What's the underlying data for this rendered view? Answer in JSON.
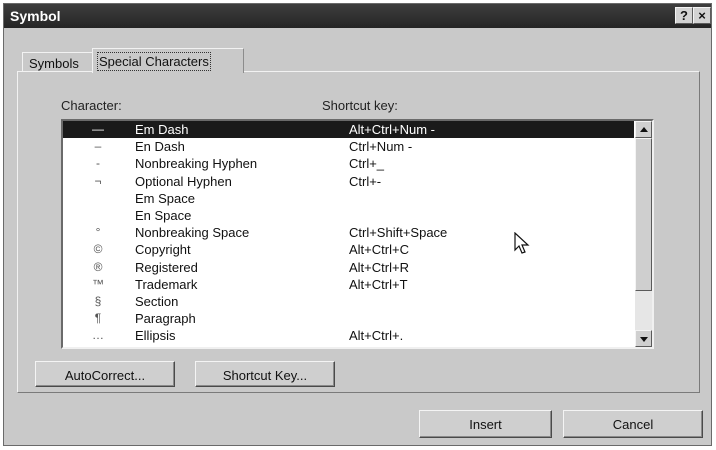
{
  "window": {
    "title": "Symbol"
  },
  "titlebar_buttons": {
    "help": "?",
    "close": "×"
  },
  "tabs": [
    {
      "label": "Symbols",
      "selected": false
    },
    {
      "label": "Special Characters",
      "selected": true
    }
  ],
  "list": {
    "character_header": "Character:",
    "shortcut_header": "Shortcut key:",
    "items": [
      {
        "glyph": "—",
        "name": "Em Dash",
        "shortcut": "Alt+Ctrl+Num -",
        "selected": true
      },
      {
        "glyph": "–",
        "name": "En Dash",
        "shortcut": "Ctrl+Num -"
      },
      {
        "glyph": "-",
        "name": "Nonbreaking Hyphen",
        "shortcut": "Ctrl+_"
      },
      {
        "glyph": "¬",
        "name": "Optional Hyphen",
        "shortcut": "Ctrl+-"
      },
      {
        "glyph": "",
        "name": "Em Space",
        "shortcut": ""
      },
      {
        "glyph": "",
        "name": "En Space",
        "shortcut": ""
      },
      {
        "glyph": "°",
        "name": "Nonbreaking Space",
        "shortcut": "Ctrl+Shift+Space"
      },
      {
        "glyph": "©",
        "name": "Copyright",
        "shortcut": "Alt+Ctrl+C"
      },
      {
        "glyph": "®",
        "name": "Registered",
        "shortcut": "Alt+Ctrl+R"
      },
      {
        "glyph": "™",
        "name": "Trademark",
        "shortcut": "Alt+Ctrl+T"
      },
      {
        "glyph": "§",
        "name": "Section",
        "shortcut": ""
      },
      {
        "glyph": "¶",
        "name": "Paragraph",
        "shortcut": ""
      },
      {
        "glyph": "…",
        "name": "Ellipsis",
        "shortcut": "Alt+Ctrl+."
      }
    ]
  },
  "buttons": {
    "autocorrect": "AutoCorrect...",
    "shortcut_key": "Shortcut Key...",
    "insert": "Insert",
    "cancel": "Cancel"
  }
}
